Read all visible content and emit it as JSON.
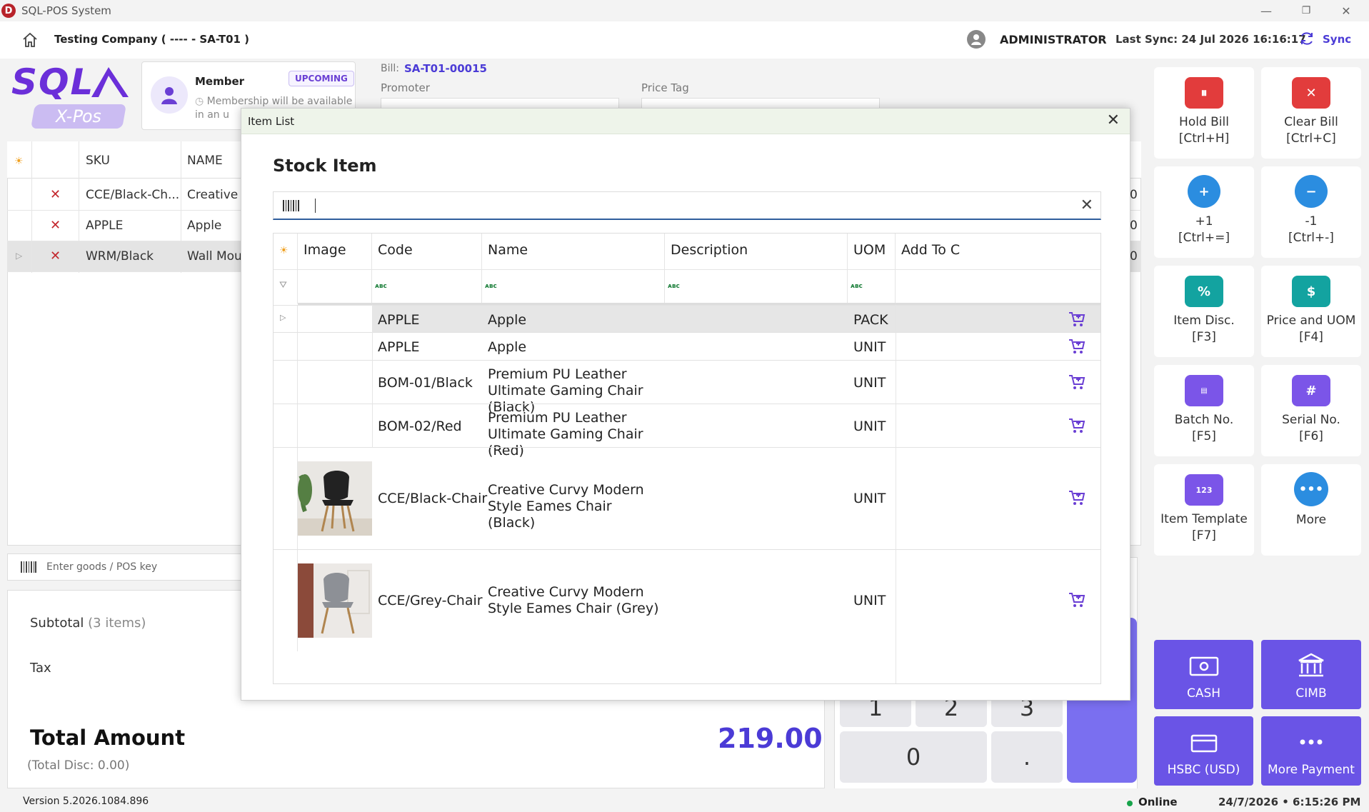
{
  "window": {
    "app_title": "SQL-POS System",
    "minimize": "—",
    "restore": "❐",
    "close": "✕"
  },
  "header": {
    "company": "Testing Company ( ---- - SA-T01 )",
    "user": "ADMINISTRATOR",
    "last_sync": "Last Sync: 24 Jul 2026 16:16:17",
    "sync_label": "Sync"
  },
  "brand": {
    "logo_text": "SQL",
    "sub_text": "X-Pos"
  },
  "member": {
    "label": "Member",
    "badge": "UPCOMING",
    "note": "Membership will be available in an u"
  },
  "bill": {
    "label": "Bill:",
    "number": "SA-T01-00015",
    "promoter_label": "Promoter",
    "price_tag_label": "Price Tag"
  },
  "cart_grid": {
    "headers": {
      "sku": "SKU",
      "name": "NAME"
    },
    "rows": [
      {
        "sku": "CCE/Black-Ch...",
        "name": "Creative C",
        "value": "0"
      },
      {
        "sku": "APPLE",
        "name": "Apple",
        "value": "0"
      },
      {
        "sku": "WRM/Black",
        "name": "Wall Mou",
        "value": "0"
      }
    ]
  },
  "scan": {
    "placeholder": "Enter goods / POS key"
  },
  "totals": {
    "subtotal_label": "Subtotal",
    "subtotal_count": "(3 items)",
    "tax_label": "Tax",
    "total_label": "Total Amount",
    "total_disc": "(Total Disc: 0.00)",
    "total_value": "219.00"
  },
  "numpad": {
    "keys": [
      "1",
      "2",
      "3",
      "0",
      "."
    ]
  },
  "actions": [
    {
      "label": "Hold Bill",
      "shortcut": "[Ctrl+H]",
      "icon": "hold-bill-icon",
      "color": "#e23c3c"
    },
    {
      "label": "Clear Bill",
      "shortcut": "[Ctrl+C]",
      "icon": "clear-bill-icon",
      "color": "#e23c3c"
    },
    {
      "label": "+1",
      "shortcut": "[Ctrl+=]",
      "icon": "plus-one-icon",
      "color": "#2b8de0"
    },
    {
      "label": "-1",
      "shortcut": "[Ctrl+-]",
      "icon": "minus-one-icon",
      "color": "#2b8de0"
    },
    {
      "label": "Item Disc.",
      "shortcut": "[F3]",
      "icon": "item-discount-icon",
      "color": "#13a3a0"
    },
    {
      "label": "Price and UOM",
      "shortcut": "[F4]",
      "icon": "price-uom-icon",
      "color": "#13a3a0"
    },
    {
      "label": "Batch No.",
      "shortcut": "[F5]",
      "icon": "batch-icon",
      "color": "#7b55e8"
    },
    {
      "label": "Serial No.",
      "shortcut": "[F6]",
      "icon": "serial-icon",
      "color": "#7b55e8"
    },
    {
      "label": "Item Template",
      "shortcut": "[F7]",
      "icon": "item-template-icon",
      "color": "#7b55e8"
    },
    {
      "label": "More",
      "shortcut": "",
      "icon": "more-icon",
      "color": "#2b8de0"
    }
  ],
  "payments": [
    {
      "label": "CASH",
      "icon": "cash-icon"
    },
    {
      "label": "CIMB",
      "icon": "bank-icon"
    },
    {
      "label": "HSBC (USD)",
      "icon": "card-icon"
    },
    {
      "label": "More Payment",
      "icon": "more-payment-icon"
    }
  ],
  "footer": {
    "version": "Version 5.2026.1084.896",
    "status": "Online",
    "datetime": "24/7/2026 • 6:15:26 PM"
  },
  "modal": {
    "title": "Item List",
    "heading": "Stock Item",
    "columns": {
      "image": "Image",
      "code": "Code",
      "name": "Name",
      "description": "Description",
      "uom": "UOM",
      "add": "Add To C"
    },
    "filter_glyph": "ᴀʙc",
    "rows": [
      {
        "code": "APPLE",
        "name": "Apple",
        "uom": "PACK"
      },
      {
        "code": "APPLE",
        "name": "Apple",
        "uom": "UNIT"
      },
      {
        "code": "BOM-01/Black",
        "name": "Premium PU Leather Ultimate Gaming Chair (Black)",
        "uom": "UNIT"
      },
      {
        "code": "BOM-02/Red",
        "name": "Premium PU Leather Ultimate Gaming Chair (Red)",
        "uom": "UNIT"
      },
      {
        "code": "CCE/Black-Chair",
        "name": "Creative Curvy Modern Style Eames Chair (Black)",
        "uom": "UNIT"
      },
      {
        "code": "CCE/Grey-Chair",
        "name": "Creative Curvy Modern Style Eames Chair (Grey)",
        "uom": "UNIT"
      }
    ]
  }
}
